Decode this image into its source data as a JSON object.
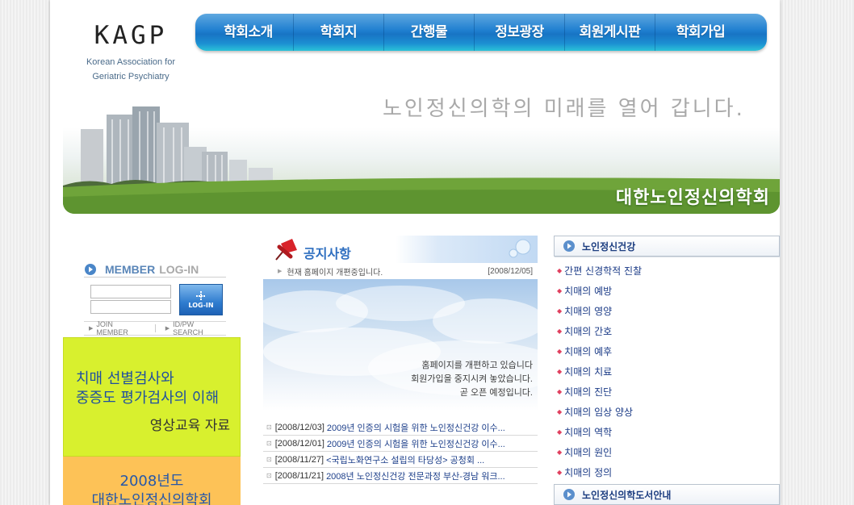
{
  "logo": {
    "mark": "KAGP",
    "subtitle_line1": "Korean Association for",
    "subtitle_line2": "Geriatric Psychiatry"
  },
  "nav": {
    "items": [
      {
        "label": "학회소개"
      },
      {
        "label": "학회지"
      },
      {
        "label": "간행물"
      },
      {
        "label": "정보광장"
      },
      {
        "label": "회원게시판"
      },
      {
        "label": "학회가입"
      }
    ]
  },
  "banner": {
    "tagline": "노인정신의학의 미래를 열어 갑니다.",
    "society_name": "대한노인정신의학회"
  },
  "login": {
    "title_member": "MEMBER",
    "title_login": "LOG-IN",
    "button_label": "LOG-IN",
    "join_label": "JOIN MEMBER",
    "find_label": "ID/PW SEARCH"
  },
  "promo_green": {
    "line1": "치매 선별검사와",
    "line2": "중증도 평가검사의 이해",
    "line3": "영상교육 자료"
  },
  "promo_orange": {
    "line1": "2008년도",
    "line2": "대한노인정신의학회"
  },
  "notice": {
    "title": "공지사항",
    "first": {
      "text": "현재 홈페이지 개편중입니다.",
      "date": "[2008/12/05]"
    },
    "panel_lines": [
      "홈페이지를 개편하고 있습니다",
      "회원가입을 중지시켜 놓았습니다.",
      "곧 오픈 예정입니다."
    ],
    "rows": [
      {
        "date": "[2008/12/03]",
        "title": "2009년 인증의 시험을 위한 노인정신건강 이수..."
      },
      {
        "date": "[2008/12/01]",
        "title": "2009년 인증의 시험을 위한 노인정신건강 이수..."
      },
      {
        "date": "[2008/11/27]",
        "title": "<국립노화연구소 설립의 타당성> 공청회 ..."
      },
      {
        "date": "[2008/11/21]",
        "title": "2008년 노인정신건강 전문과정 부산-경남 워크..."
      }
    ]
  },
  "health": {
    "title": "노인정신건강",
    "items": [
      {
        "label": "간편 신경학적 진찰"
      },
      {
        "label": "치매의 예방"
      },
      {
        "label": "치매의 영양"
      },
      {
        "label": "치매의 간호"
      },
      {
        "label": "치매의 예후"
      },
      {
        "label": "치매의 치료"
      },
      {
        "label": "치매의 진단"
      },
      {
        "label": "치매의 임상 양상"
      },
      {
        "label": "치매의 역학"
      },
      {
        "label": "치매의 원인"
      },
      {
        "label": "치매의 정의"
      }
    ]
  },
  "library": {
    "title": "노인정신의학도서안내"
  },
  "colors": {
    "nav_blue": "#1f7fd0",
    "promo_green": "#d8f02e",
    "promo_orange": "#fdc257",
    "link_navy": "#1a3a86"
  }
}
